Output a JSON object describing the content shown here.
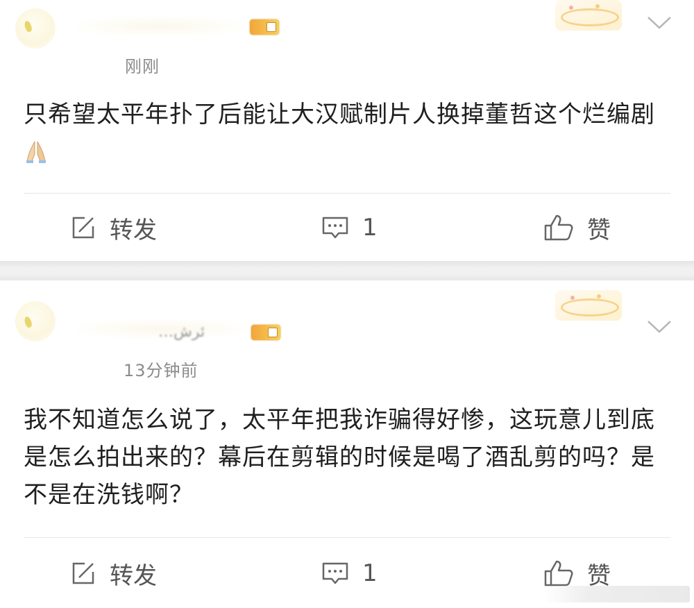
{
  "posts": [
    {
      "user_name": "",
      "time": "刚刚",
      "content": "只希望太平年扑了后能让大汉赋制片人换掉董哲这个烂编剧",
      "emoji": "pray-hands-icon",
      "actions": {
        "repost": "转发",
        "comment_count": "1",
        "like": "赞"
      }
    },
    {
      "user_name": "…ئرش",
      "time": "13分钟前",
      "content": "我不知道怎么说了，太平年把我诈骗得好惨，这玩意儿到底是怎么拍出来的？幕后在剪辑的时候是喝了酒乱剪的吗？是不是在洗钱啊？",
      "actions": {
        "repost": "转发",
        "comment_count": "1",
        "like": "赞"
      }
    }
  ],
  "colors": {
    "text_primary": "#1f1f1f",
    "text_secondary": "#8b8b8b",
    "icon": "#666666",
    "separator": "#f1f1f1",
    "divider": "#e6e6e6"
  }
}
